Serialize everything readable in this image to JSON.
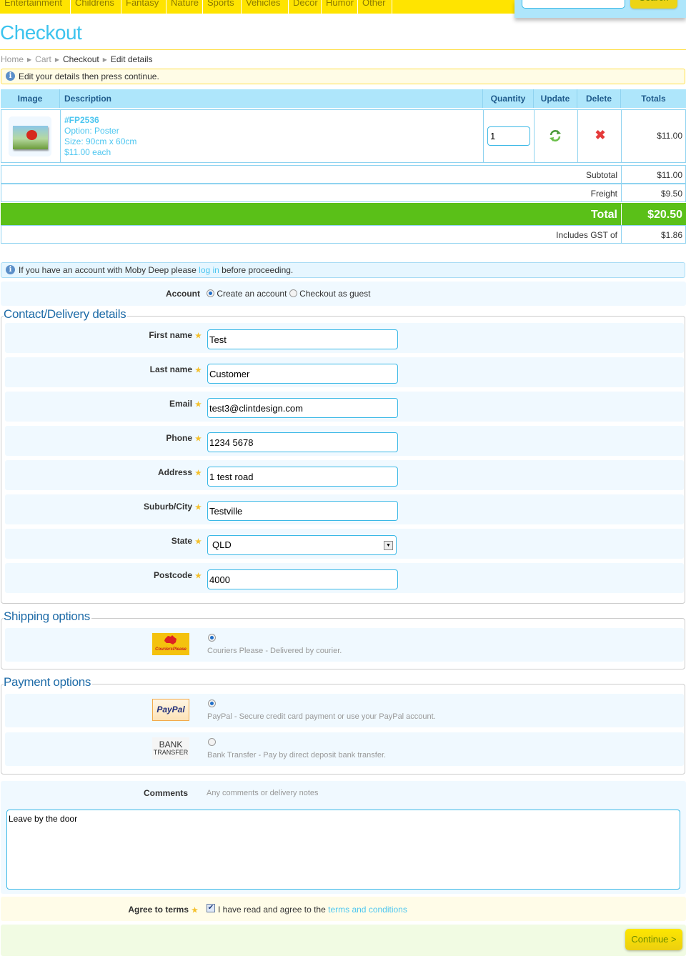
{
  "nav": {
    "categories": [
      "Entertainment",
      "Childrens",
      "Fantasy",
      "Nature",
      "Sports",
      "Vehicles",
      "Decor",
      "Humor",
      "Other"
    ],
    "search_placeholder": "",
    "search_button": "Search"
  },
  "page": {
    "title": "Checkout",
    "breadcrumb": [
      "Home",
      "Cart",
      "Checkout",
      "Edit details"
    ],
    "notice": "Edit your details then press continue."
  },
  "cart": {
    "headers": {
      "image": "Image",
      "description": "Description",
      "quantity": "Quantity",
      "update": "Update",
      "delete": "Delete",
      "totals": "Totals"
    },
    "items": [
      {
        "code": "#FP2536",
        "option": "Option: Poster",
        "size": "Size: 90cm x 60cm",
        "price_each": "$11.00 each",
        "quantity": "1",
        "total": "$11.00",
        "update_icon": "refresh-icon",
        "delete_icon": "delete-x-icon"
      }
    ],
    "summary": {
      "subtotal_label": "Subtotal",
      "subtotal": "$11.00",
      "freight_label": "Freight",
      "freight": "$9.50",
      "total_label": "Total",
      "total": "$20.50",
      "gst_label": "Includes GST of",
      "gst": "$1.86"
    }
  },
  "login_notice": {
    "before": "If you have an account with Moby Deep please ",
    "link": "log in",
    "after": " before proceeding."
  },
  "account": {
    "label": "Account",
    "options": [
      {
        "label": "Create an account",
        "selected": true
      },
      {
        "label": "Checkout as guest",
        "selected": false
      }
    ]
  },
  "contact": {
    "legend": "Contact/Delivery details",
    "fields": [
      {
        "label": "First name",
        "value": "Test"
      },
      {
        "label": "Last name",
        "value": "Customer"
      },
      {
        "label": "Email",
        "value": "test3@clintdesign.com"
      },
      {
        "label": "Phone",
        "value": "1234 5678"
      },
      {
        "label": "Address",
        "value": "1 test road"
      },
      {
        "label": "Suburb/City",
        "value": "Testville"
      },
      {
        "label": "State",
        "value": "QLD"
      },
      {
        "label": "Postcode",
        "value": "4000"
      }
    ]
  },
  "shipping": {
    "legend": "Shipping options",
    "options": [
      {
        "logo": "CouriersPlease",
        "description": "Couriers Please - Delivered by courier.",
        "selected": true
      }
    ]
  },
  "payment": {
    "legend": "Payment options",
    "options": [
      {
        "logo": "PayPal",
        "description": "PayPal - Secure credit card payment or use your PayPal account.",
        "selected": true
      },
      {
        "logo_line1": "BANK",
        "logo_line2": "TRANSFER",
        "description": "Bank Transfer - Pay by direct deposit bank transfer.",
        "selected": false
      }
    ]
  },
  "comments": {
    "label": "Comments",
    "hint": "Any comments or delivery notes",
    "value": "Leave by the door"
  },
  "terms": {
    "label": "Agree to terms",
    "checked": true,
    "text": "I have read and agree to the ",
    "link": "terms and conditions"
  },
  "continue_button": "Continue >",
  "colors": {
    "brand_yellow": "#ffe400",
    "accent_blue": "#3cc3ee",
    "header_blue": "#aee6fb",
    "total_green": "#5ac018"
  }
}
